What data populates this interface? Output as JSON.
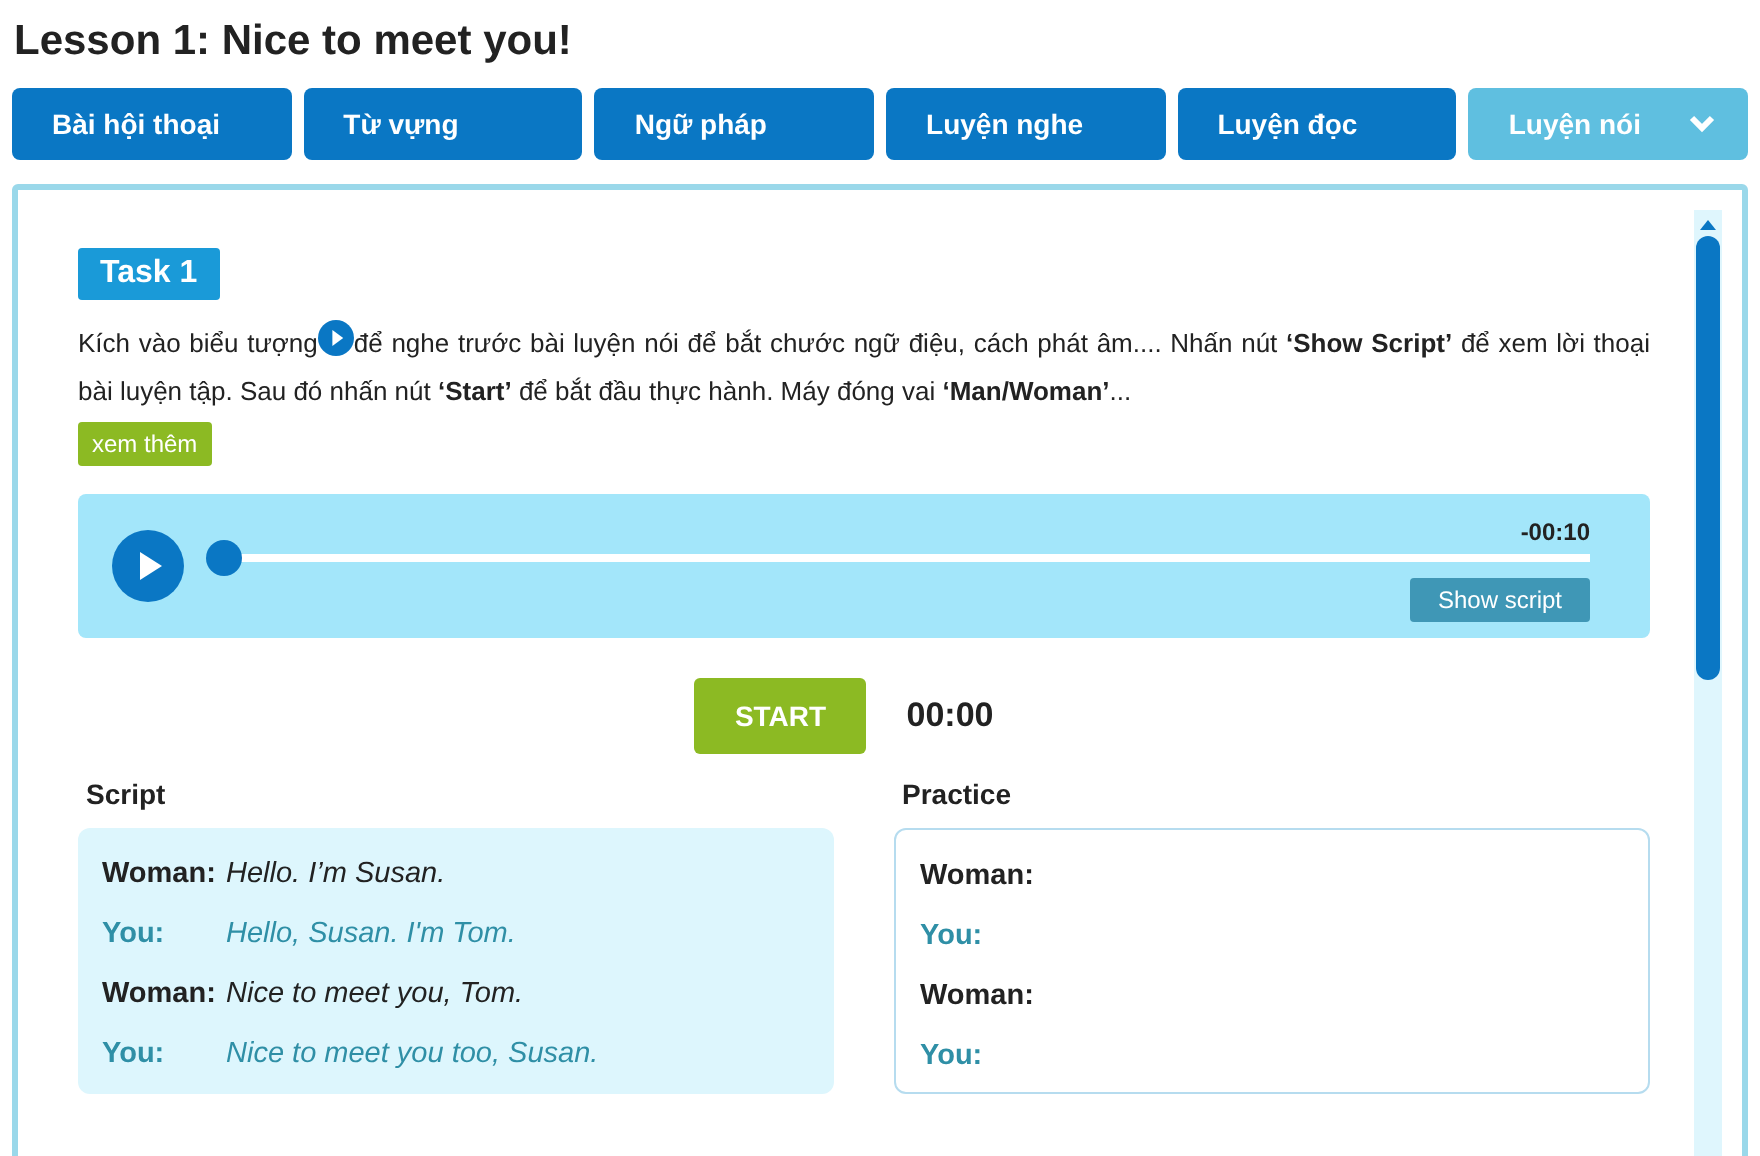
{
  "title": "Lesson 1: Nice to meet you!",
  "tabs": [
    {
      "label": "Bài hội thoại",
      "selected": false
    },
    {
      "label": "Từ vựng",
      "selected": false
    },
    {
      "label": "Ngữ pháp",
      "selected": false
    },
    {
      "label": "Luyện nghe",
      "selected": false
    },
    {
      "label": "Luyện đọc",
      "selected": false
    },
    {
      "label": "Luyện nói",
      "selected": true
    }
  ],
  "task": {
    "label": "Task 1",
    "instruction_before": "Kích vào biểu tượng",
    "instruction_after": "để nghe trước bài luyện nói để bắt chước ngữ điệu, cách phát âm.... Nhấn nút **‘Show Script’** để xem lời thoại bài luyện tập. Sau đó nhấn nút **‘Start’** để bắt đầu thực hành. Máy đóng vai **‘Man/Woman’**...",
    "more": "xem thêm"
  },
  "player": {
    "time": "-00:10",
    "level": 0,
    "show_script": "Show script"
  },
  "start": {
    "label": "START",
    "timer": "00:00"
  },
  "script": {
    "heading": "Script",
    "lines": [
      {
        "kind": "other",
        "speaker": "Woman:",
        "text": "Hello. I’m Susan."
      },
      {
        "kind": "you",
        "speaker": "You:",
        "text": "Hello, Susan. I'm Tom."
      },
      {
        "kind": "other",
        "speaker": "Woman:",
        "text": "Nice to meet you, Tom."
      },
      {
        "kind": "you",
        "speaker": "You:",
        "text": "Nice to meet you too, Susan."
      }
    ]
  },
  "practice": {
    "heading": "Practice",
    "lines": [
      {
        "kind": "other",
        "speaker": "Woman:"
      },
      {
        "kind": "you",
        "speaker": "You:"
      },
      {
        "kind": "other",
        "speaker": "Woman:"
      },
      {
        "kind": "you",
        "speaker": "You:"
      }
    ]
  }
}
